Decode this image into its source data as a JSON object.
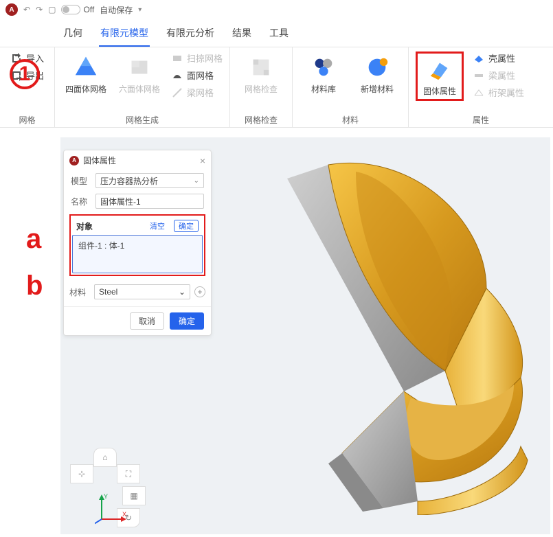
{
  "titlebar": {
    "off_text": "Off",
    "autosave": "自动保存"
  },
  "tabs": {
    "geometry": "几何",
    "fem_model": "有限元模型",
    "fem_analysis": "有限元分析",
    "result": "结果",
    "tool": "工具"
  },
  "ribbon": {
    "mesh_group": "网格",
    "import": "导入",
    "export": "导出",
    "mesh_gen_group": "网格生成",
    "tet_mesh": "四面体网格",
    "hex_mesh": "六面体网格",
    "sweep_mesh": "扫掠网格",
    "surf_mesh": "面网格",
    "beam_mesh": "梁网格",
    "mesh_check_group": "网格检查",
    "mesh_check": "网格检查",
    "material_group": "材料",
    "mat_lib": "材料库",
    "new_mat": "新增材料",
    "prop_group": "属性",
    "solid_prop": "固体属性",
    "shell_prop": "壳属性",
    "beam_prop": "梁属性",
    "truss_prop": "桁架属性"
  },
  "panel": {
    "title": "固体属性",
    "model_label": "模型",
    "model_value": "压力容器热分析",
    "name_label": "名称",
    "name_value": "固体属性-1",
    "object_label": "对象",
    "clear": "清空",
    "ok_small": "确定",
    "object_value": "组件-1 : 体-1",
    "material_label": "材料",
    "material_value": "Steel",
    "cancel": "取消",
    "ok": "确定"
  },
  "annotations": {
    "one": "1",
    "a": "a",
    "b": "b"
  }
}
